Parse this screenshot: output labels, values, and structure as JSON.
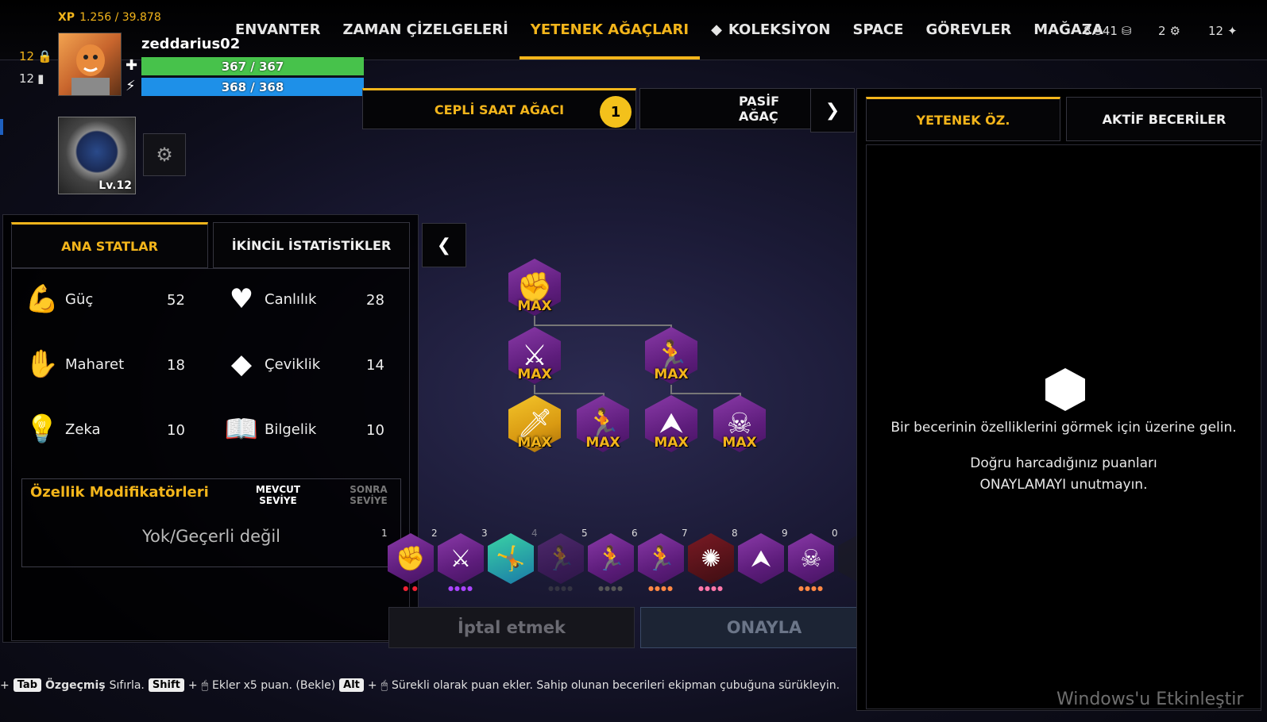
{
  "player": {
    "xp_label": "XP",
    "xp_value": "1.256 / 39.878",
    "level_a": "12",
    "level_b": "12",
    "username": "zeddarius02",
    "hp": "367 / 367",
    "mp": "368 / 368",
    "pocket_watch_level": "Lv.12"
  },
  "nav": {
    "items": [
      {
        "label": "ENVANTER"
      },
      {
        "label": "ZAMAN ÇİZELGELERİ"
      },
      {
        "label": "YETENEK AĞAÇLARI"
      },
      {
        "label": "KOLEKSİYON"
      },
      {
        "label": "SPACE"
      },
      {
        "label": "GÖREVLER"
      },
      {
        "label": "MAĞAZA"
      }
    ],
    "active": "YETENEK AĞAÇLARI"
  },
  "currency": {
    "coins": "8.541",
    "gears": "2",
    "shards": "12"
  },
  "stats": {
    "tab_main": "ANA STATLAR",
    "tab_secondary": "İKİNCİL İSTATİSTİKLER",
    "items": [
      {
        "name": "Güç",
        "value": "52"
      },
      {
        "name": "Canlılık",
        "value": "28"
      },
      {
        "name": "Maharet",
        "value": "18"
      },
      {
        "name": "Çeviklik",
        "value": "14"
      },
      {
        "name": "Zeka",
        "value": "10"
      },
      {
        "name": "Bilgelik",
        "value": "10"
      }
    ],
    "modifiers_title": "Özellik Modifikatörleri",
    "col_current": "MEVCUT SEVİYE",
    "col_next": "SONRA SEVİYE",
    "modifiers_empty": "Yok/Geçerli değil"
  },
  "tree": {
    "tab_active": "CEPLİ SAAT AĞACI",
    "tab_active_badge": "1",
    "tab_passive": "PASİF AĞAÇ",
    "max_label": "MAX"
  },
  "hotbar": {
    "slots": [
      "1",
      "2",
      "3",
      "4",
      "5",
      "6",
      "7",
      "8",
      "9",
      "0"
    ]
  },
  "buttons": {
    "cancel": "İptal etmek",
    "confirm": "ONAYLA"
  },
  "right_panel": {
    "tab_summary": "YETENEK ÖZ.",
    "tab_active_skills": "AKTİF BECERİLER",
    "hint_1": "Bir becerinin özelliklerini görmek için üzerine gelin.",
    "hint_2": "Doğru harcadığınız puanları ONAYLAMAYI unutmayın."
  },
  "footer": {
    "key_tab": "Tab",
    "tab_text": "Özgeçmiş",
    "reset_text": "Sıfırla.",
    "key_shift": "Shift",
    "shift_text": "Ekler x5 puan. (Bekle)",
    "key_alt": "Alt",
    "alt_text": "Sürekli olarak puan ekler. Sahip olunan becerileri ekipman çubuğuna sürükleyin."
  },
  "watermark": "Windows'u Etkinleştir",
  "colors": {
    "accent": "#f3b51b",
    "hp": "#47c24b",
    "mp": "#1e90e8",
    "skill_purple": "#6a2290",
    "skill_gold": "#e3a51a"
  }
}
